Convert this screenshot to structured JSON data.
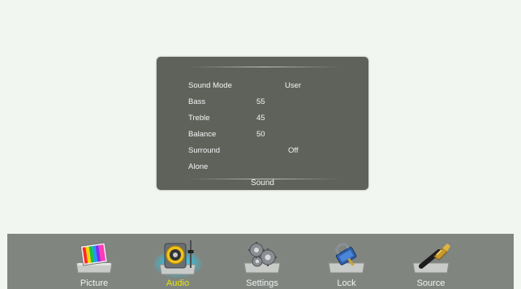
{
  "sound_menu": {
    "title": "Sound",
    "rows": [
      {
        "label": "Sound Mode",
        "value": "User"
      },
      {
        "label": "Bass",
        "value": "55"
      },
      {
        "label": "Treble",
        "value": "45"
      },
      {
        "label": "Balance",
        "value": "50"
      },
      {
        "label": "Surround",
        "value": "Off"
      },
      {
        "label": "Alone",
        "value": ""
      }
    ]
  },
  "bottom_nav": {
    "items": [
      {
        "label": "Picture",
        "icon": "picture-icon",
        "active": false
      },
      {
        "label": "Audio",
        "icon": "speaker-icon",
        "active": true
      },
      {
        "label": "Settings",
        "icon": "gears-icon",
        "active": false
      },
      {
        "label": "Lock",
        "icon": "lock-icon",
        "active": false
      },
      {
        "label": "Source",
        "icon": "hdmi-cable-icon",
        "active": false
      }
    ]
  },
  "colors": {
    "background": "#f1f6f1",
    "dialog": "#5f625b",
    "nav_bar": "#818580",
    "active_label": "#e6e600",
    "glow": "#40d0f0"
  }
}
